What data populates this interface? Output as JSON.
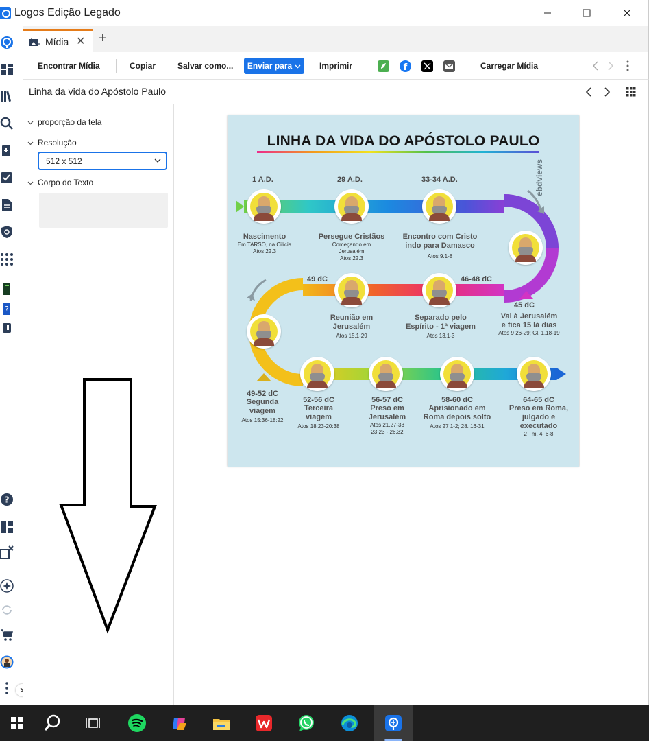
{
  "window": {
    "title": "Logos Edição Legado",
    "minimize_icon": "minimize-icon",
    "maximize_icon": "maximize-icon",
    "close_icon": "close-icon"
  },
  "tabs": {
    "items": [
      {
        "label": "Mídia",
        "active": true
      }
    ],
    "accent_color": "#e57c1a"
  },
  "toolbar": {
    "find_media": "Encontrar Mídia",
    "copy": "Copiar",
    "save_as": "Salvar como...",
    "send_to": "Enviar para",
    "print": "Imprimir",
    "load_media": "Carregar Mídia",
    "accent_color": "#1a73e8"
  },
  "breadcrumb": {
    "title": "Linha da vida do Apóstolo Paulo"
  },
  "panel": {
    "aspect_ratio_label": "proporção da tela",
    "resolution_label": "Resolução",
    "resolution_value": "512 x 512",
    "body_text_label": "Corpo do Texto"
  },
  "infographic": {
    "title": "LINHA DA VIDA DO APÓSTOLO PAULO",
    "brand": "ebdviews",
    "events": [
      {
        "year": "1 A.D.",
        "event": "Nascimento",
        "notes": [
          "Em TARSO, na Cilícia",
          "Atos 22.3"
        ]
      },
      {
        "year": "29 A.D.",
        "event": "Persegue Cristãos",
        "notes": [
          "Começando em",
          "Jerusalém",
          "Atos 22.3"
        ]
      },
      {
        "year": "33-34 A.D.",
        "event_lines": [
          "Encontro com Cristo",
          "indo para Damasco"
        ],
        "notes": [
          "Atos 9.1-8"
        ]
      },
      {
        "year": "45 dC",
        "event_lines": [
          "Vai à Jerusalém",
          "e fica 15 lá dias"
        ],
        "notes": [
          "Atos 9 26-29; Gl. 1.18-19"
        ]
      },
      {
        "year": "46-48 dC",
        "event_lines": [
          "Separado pelo",
          "Espírito - 1ª viagem"
        ],
        "notes": [
          "Atos 13.1-3"
        ]
      },
      {
        "year": "49 dC",
        "event_lines": [
          "Reunião em",
          "Jerusalém"
        ],
        "notes": [
          "Atos 15.1-29"
        ]
      },
      {
        "year": "49-52 dC",
        "event_lines": [
          "Segunda",
          "viagem"
        ],
        "notes": [
          "Atos 15:36-18:22"
        ]
      },
      {
        "year": "52-56 dC",
        "event_lines": [
          "Terceira",
          "viagem"
        ],
        "notes": [
          "Atos 18:23-20:38"
        ]
      },
      {
        "year": "56-57 dC",
        "event_lines": [
          "Preso em",
          "Jerusalém"
        ],
        "notes": [
          "Atos 21.27-33",
          "23.23 - 26.32"
        ]
      },
      {
        "year": "58-60 dC",
        "event_lines": [
          "Aprisionado em",
          "Roma depois solto"
        ],
        "notes": [
          "Atos 27 1-2; 28. 16-31"
        ]
      },
      {
        "year": "64-65 dC",
        "event_lines": [
          "Preso em Roma,",
          "julgado e",
          "executado"
        ],
        "notes": [
          "2 Tm. 4. 6-8"
        ]
      }
    ]
  },
  "taskbar": {
    "items": [
      "windows-start-icon",
      "search-icon",
      "task-view-icon",
      "spotify-icon",
      "copilot-icon",
      "file-explorer-icon",
      "wps-office-icon",
      "whatsapp-icon",
      "edge-icon",
      "logos-icon"
    ],
    "active_item": "logos-icon"
  }
}
